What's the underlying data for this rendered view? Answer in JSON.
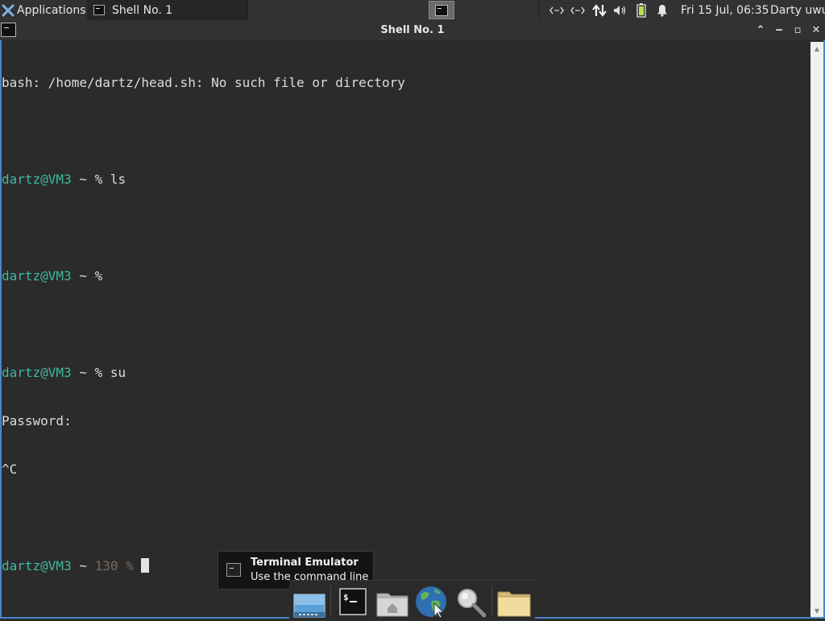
{
  "panel": {
    "applications_label": "Applications",
    "task_label": "Shell No. 1",
    "clock": "Fri 15 Jul, 06:35",
    "user": "Darty uwu",
    "tray_icons": [
      "network-icon",
      "network-icon",
      "transfer-icon",
      "volume-icon",
      "battery-icon",
      "notification-bell-icon"
    ]
  },
  "window": {
    "title": "Shell No. 1",
    "buttons": {
      "collapse": "⌃",
      "minimize": "‒",
      "maximize": "▫",
      "close": "✕"
    }
  },
  "terminal": {
    "lines": [
      {
        "type": "text",
        "text": "bash: /home/dartz/head.sh: No such file or directory"
      },
      {
        "type": "blank"
      },
      {
        "type": "prompt",
        "user": "dartz@VM3",
        "tail": " ~ % ls"
      },
      {
        "type": "blank"
      },
      {
        "type": "prompt",
        "user": "dartz@VM3",
        "tail": " ~ %"
      },
      {
        "type": "blank"
      },
      {
        "type": "prompt",
        "user": "dartz@VM3",
        "tail": " ~ % su"
      },
      {
        "type": "text",
        "text": "Password:"
      },
      {
        "type": "text",
        "text": "^C"
      },
      {
        "type": "blank"
      },
      {
        "type": "prompt_exit",
        "user": "dartz@VM3",
        "tail": " ~ ",
        "exit": "130 %"
      }
    ],
    "colors": {
      "user_host": "#3fb8a0",
      "exit_code": "#7a6a60",
      "foreground": "#dcdcdc",
      "background": "#2b2b2b"
    }
  },
  "tooltip": {
    "title": "Terminal Emulator",
    "subtitle": "Use the command line"
  },
  "dock": {
    "items": [
      "show-desktop-icon",
      "terminal-icon",
      "home-folder-icon",
      "web-browser-icon",
      "search-icon",
      "folder-icon"
    ]
  }
}
